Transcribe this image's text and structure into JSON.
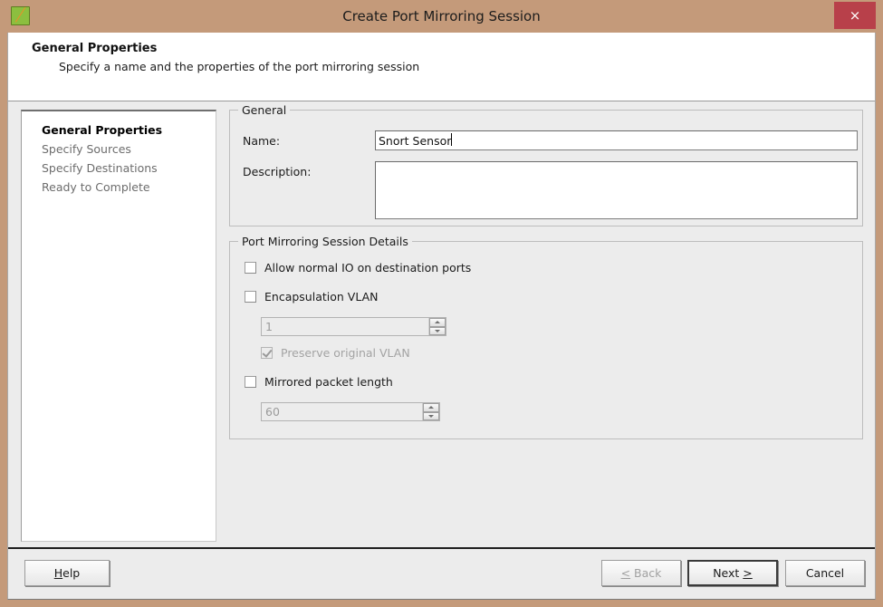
{
  "window": {
    "title": "Create Port Mirroring Session",
    "icon": "app-icon",
    "close_label": "×",
    "accent_frame_color": "#c49a7a",
    "close_button_color": "#b8404a"
  },
  "header": {
    "title": "General Properties",
    "subtitle": "Specify a name and the properties of the port mirroring session"
  },
  "sidebar": {
    "items": [
      {
        "label": "General Properties",
        "active": true
      },
      {
        "label": "Specify Sources",
        "active": false
      },
      {
        "label": "Specify Destinations",
        "active": false
      },
      {
        "label": "Ready to Complete",
        "active": false
      }
    ]
  },
  "general_group": {
    "title": "General",
    "name_label": "Name:",
    "name_value": "Snort Sensor",
    "name_placeholder": "",
    "description_label": "Description:",
    "description_value": "",
    "description_placeholder": ""
  },
  "details_group": {
    "title": "Port Mirroring Session Details",
    "allow_normal_io": {
      "label": "Allow normal IO on destination ports",
      "checked": false,
      "disabled": false
    },
    "encapsulation_vlan": {
      "label": "Encapsulation VLAN",
      "checked": false,
      "disabled": false
    },
    "vlan_spinner": {
      "value": "1",
      "disabled": true
    },
    "preserve_original_vlan": {
      "label": "Preserve original VLAN",
      "checked": true,
      "disabled": true
    },
    "mirrored_packet_length": {
      "label": "Mirrored packet length",
      "checked": false,
      "disabled": false
    },
    "packet_length_spinner": {
      "value": "60",
      "disabled": true
    }
  },
  "buttons": {
    "help": {
      "label": "Help",
      "mnemonic": "H",
      "disabled": false
    },
    "back": {
      "prefix": "<",
      "label": " Back",
      "disabled": true
    },
    "next": {
      "label": "Next ",
      "suffix": ">",
      "disabled": false,
      "is_default": true
    },
    "cancel": {
      "label": "Cancel",
      "disabled": false
    }
  }
}
